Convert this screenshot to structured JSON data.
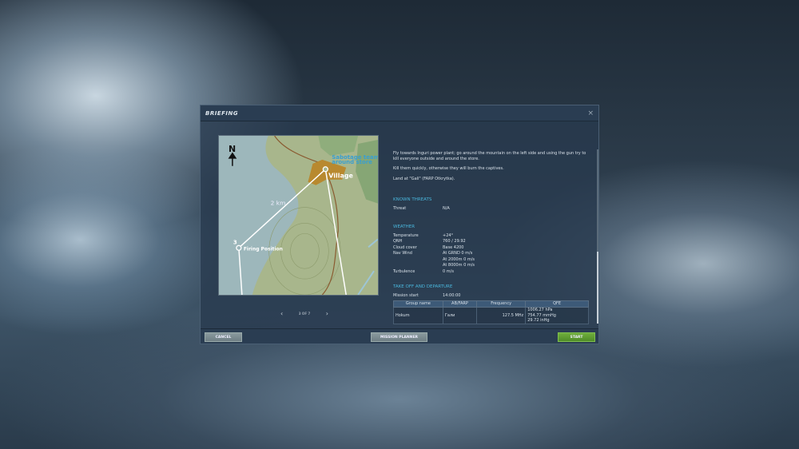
{
  "dialog": {
    "title": "BRIEFING",
    "close": "×"
  },
  "map": {
    "north": "N",
    "target_label_1": "Sabotage team",
    "target_label_2": "around store",
    "village": "Village",
    "distance": "2 km",
    "waypoint_number": "3",
    "waypoint_label": "Firing Position"
  },
  "pager": {
    "prev": "‹",
    "next": "›",
    "text": "3 OF 7"
  },
  "briefing": {
    "paragraphs": [
      "Fly towards Inguri power plant; go around the mountain on the left side and using the gun try to kill everyone outside and around the store.",
      "Kill them quickly, otherwise they will burn the captives.",
      "Land at \"Gali\" (FARP Otkrytka)."
    ],
    "threats_title": "KNOWN THREATS",
    "threat_label": "Threat",
    "threat_value": "N/A",
    "weather_title": "WEATHER",
    "weather": [
      {
        "k": "Temperature",
        "v": "+24°"
      },
      {
        "k": "QNH",
        "v": "760 / 29.92"
      },
      {
        "k": "Cloud cover",
        "v": "Base 4200"
      },
      {
        "k": "Nav Wind",
        "v": "At GRND 0 m/s"
      },
      {
        "k": "",
        "v": "At 2000m 0 m/s"
      },
      {
        "k": "",
        "v": "At 8000m 0 m/s"
      },
      {
        "k": "Turbulence",
        "v": "0 m/s"
      }
    ],
    "departure_title": "TAKE OFF AND DEPARTURE",
    "mission_start_label": "Mission start",
    "mission_start": "14:00:00",
    "table": {
      "headers": [
        "Group name",
        "AB/FARP",
        "Frequency",
        "QFE"
      ],
      "row": [
        "Hokum",
        "Гали",
        "127.5 MHz",
        "1006.27 hPa",
        "754.77 mmHg",
        "29.72 inHg"
      ]
    }
  },
  "footer": {
    "cancel": "CANCEL",
    "planner": "MISSION PLANNER",
    "start": "START"
  }
}
